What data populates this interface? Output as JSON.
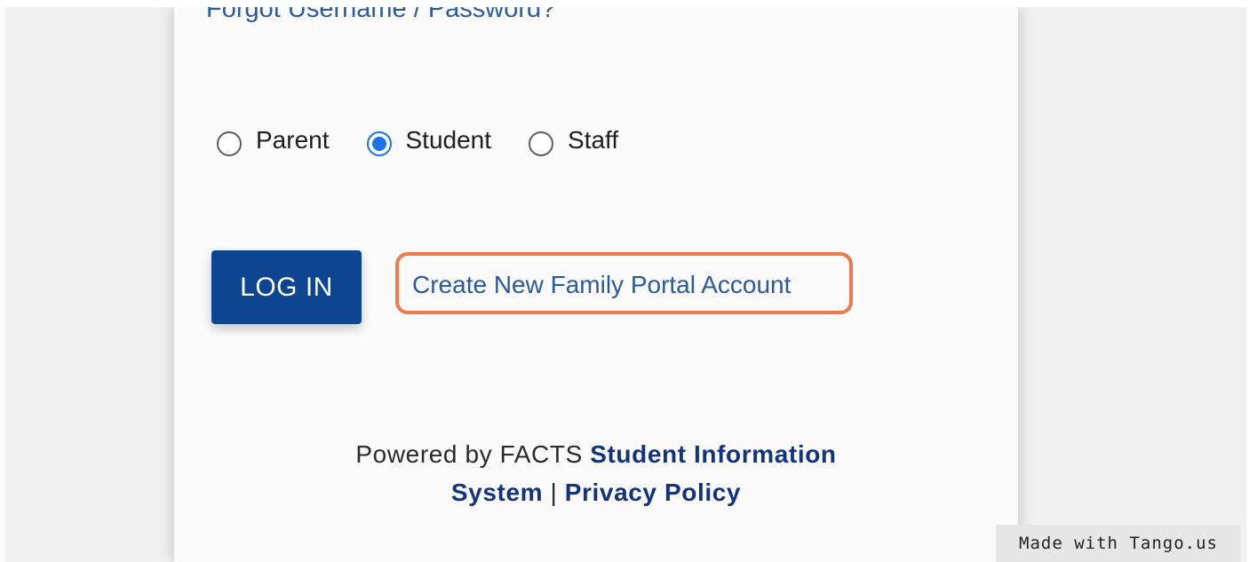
{
  "login": {
    "forgot_link": "Forgot Username / Password?",
    "roles": [
      {
        "label": "Parent",
        "checked": false
      },
      {
        "label": "Student",
        "checked": true
      },
      {
        "label": "Staff",
        "checked": false
      }
    ],
    "login_button": "LOG IN",
    "create_account_link": "Create New Family Portal Account"
  },
  "footer": {
    "powered_by": "Powered by FACTS ",
    "sis_link_line1": "Student Information",
    "sis_link_line2": "System",
    "separator": " | ",
    "privacy_link": "Privacy Policy"
  },
  "badge": {
    "text": "Made with Tango.us"
  },
  "colors": {
    "primary_button": "#0d4591",
    "link": "#2c5a9a",
    "radio_checked": "#1a73e8",
    "highlight": "#f07a4b"
  }
}
